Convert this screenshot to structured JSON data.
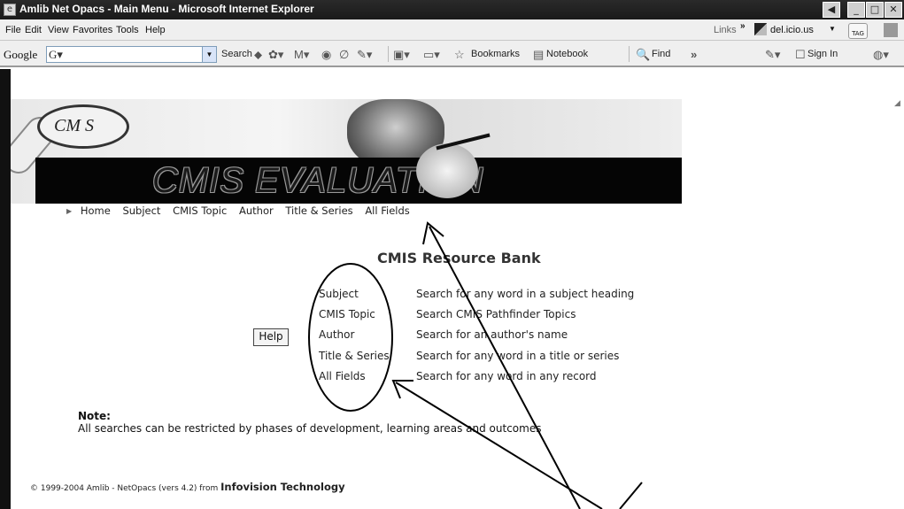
{
  "window": {
    "title": "Amlib Net Opacs - Main Menu  - Microsoft Internet Explorer"
  },
  "menubar": {
    "items": [
      "File",
      "Edit",
      "View",
      "Favorites",
      "Tools",
      "Help"
    ],
    "links_label": "Links",
    "delicious_label": "del.icio.us",
    "tag_label": "TAG"
  },
  "google_toolbar": {
    "logo": "Google",
    "search_label": "Search",
    "bookmarks_label": "Bookmarks",
    "notebook_label": "Notebook",
    "find_label": "Find",
    "signin_label": "Sign In"
  },
  "banner": {
    "logo_text": "CM S",
    "title": "CMIS EVALUATION"
  },
  "nav": {
    "items": [
      "Home",
      "Subject",
      "CMIS Topic",
      "Author",
      "Title & Series",
      "All Fields"
    ]
  },
  "main": {
    "heading": "CMIS Resource Bank",
    "help_label": "Help",
    "search_options": [
      {
        "label": "Subject",
        "description": "Search for any word in a subject heading"
      },
      {
        "label": "CMIS Topic",
        "description": "Search CMIS Pathfinder Topics"
      },
      {
        "label": "Author",
        "description": "Search for an author's name"
      },
      {
        "label": "Title & Series",
        "description": "Search for any word in a title or series"
      },
      {
        "label": "All Fields",
        "description": "Search for any word in any record"
      }
    ],
    "note_title": "Note:",
    "note_text": "All searches can be restricted by phases of development, learning areas and outcomes"
  },
  "footer": {
    "text": "© 1999-2004 Amlib - NetOpacs (vers 4.2) from ",
    "brand": "Infovision Technology"
  }
}
